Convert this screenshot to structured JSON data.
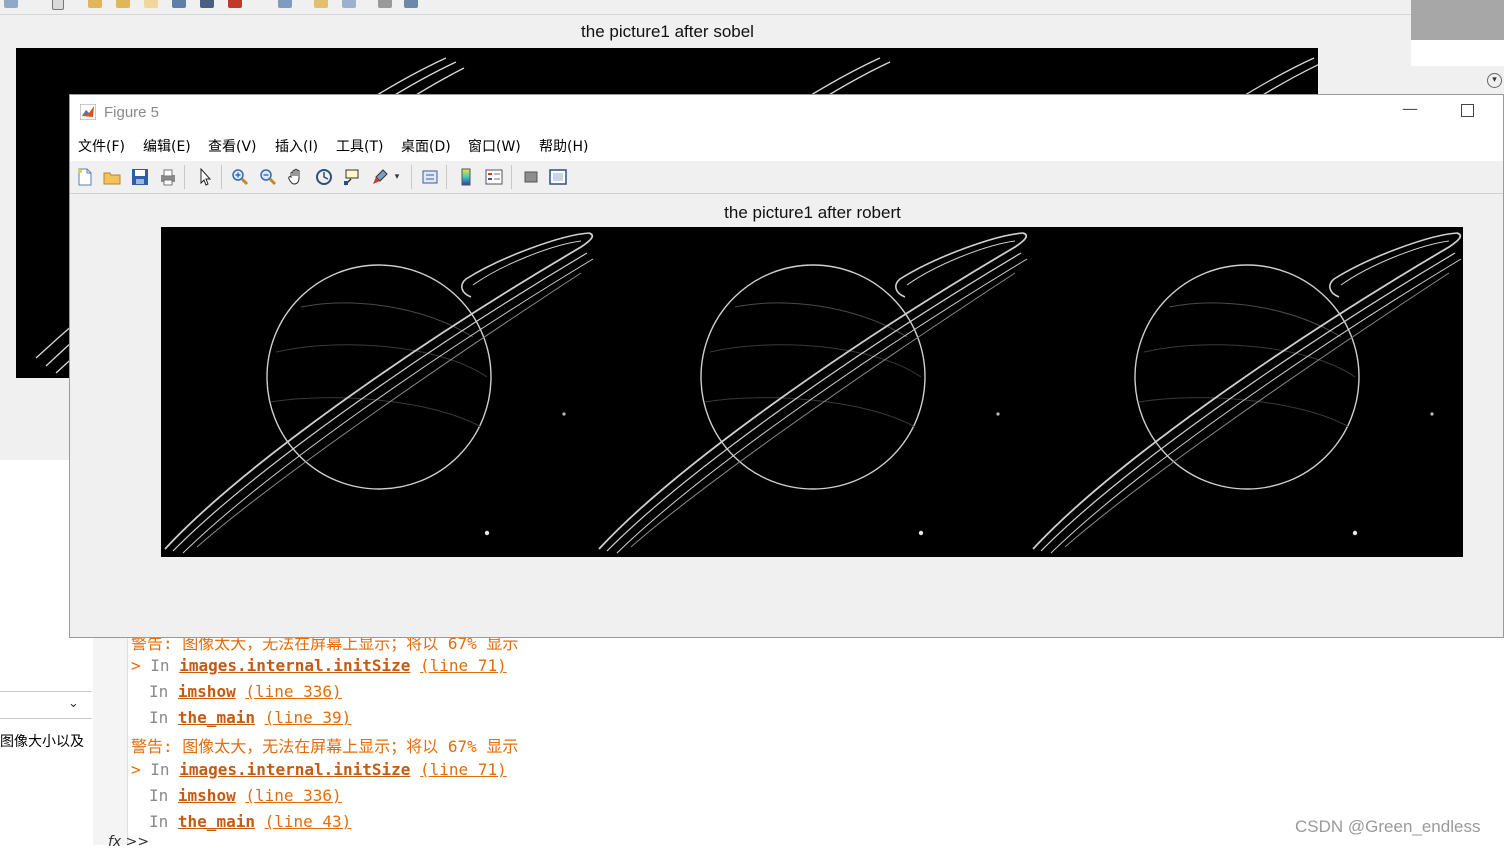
{
  "background_figure": {
    "axes_title": "the picture1 after sobel"
  },
  "left_panel": {
    "text": "图像大小以及"
  },
  "command_window": {
    "partial_warning": "警告: 图像太大，无法在屏幕上显示；将以 67% 显示",
    "block1": {
      "trace": [
        {
          "prefix": "> In ",
          "func": "images.internal.initSize",
          "line": "(line 71)"
        },
        {
          "prefix": "In ",
          "func": "imshow",
          "line": "(line 336)"
        },
        {
          "prefix": "In ",
          "func": "the_main",
          "line": "(line 39)"
        }
      ]
    },
    "warning2": "警告: 图像太大，无法在屏幕上显示；将以 67% 显示",
    "block2": {
      "trace": [
        {
          "prefix": "> In ",
          "func": "images.internal.initSize",
          "line": "(line 71)"
        },
        {
          "prefix": "In ",
          "func": "imshow",
          "line": "(line 336)"
        },
        {
          "prefix": "In ",
          "func": "the_main",
          "line": "(line 43)"
        }
      ]
    },
    "prompt": "fx >>"
  },
  "figure5": {
    "window_title": "Figure 5",
    "menu": [
      "文件(F)",
      "编辑(E)",
      "查看(V)",
      "插入(I)",
      "工具(T)",
      "桌面(D)",
      "窗口(W)",
      "帮助(H)"
    ],
    "toolbar_icons": [
      "new-figure-icon",
      "open-file-icon",
      "save-icon",
      "print-icon",
      "pointer-icon",
      "zoom-in-icon",
      "zoom-out-icon",
      "pan-hand-icon",
      "rotate-3d-icon",
      "data-cursor-icon",
      "brush-icon",
      "link-plot-icon",
      "colorbar-icon",
      "legend-icon",
      "hide-plot-tools-icon",
      "show-plot-tools-icon"
    ],
    "axes_title": "the picture1 after robert",
    "colors": {
      "accent": "#e46c0a",
      "link": "#c55a11"
    }
  },
  "watermark": "CSDN @Green_endless"
}
